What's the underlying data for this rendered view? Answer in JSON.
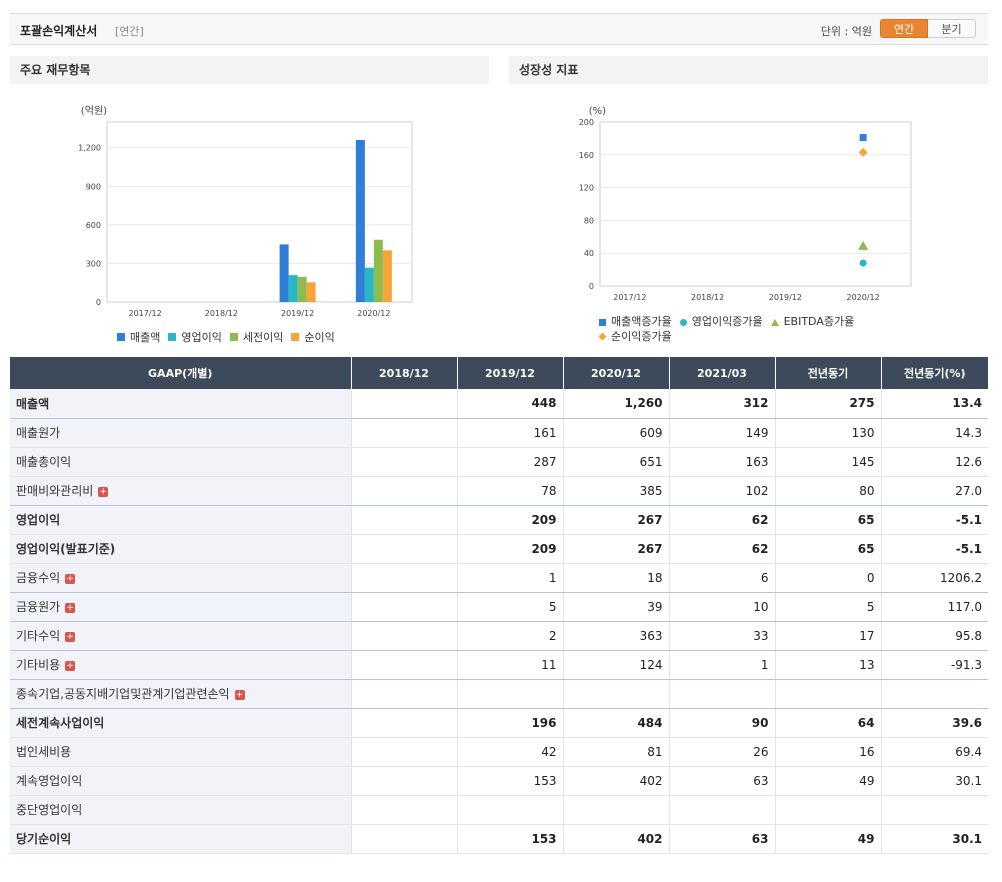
{
  "header": {
    "title": "포괄손익계산서",
    "period": "[연간]",
    "unit": "단위 : 억원",
    "toggle": [
      "연간",
      "분기"
    ]
  },
  "panel_left": {
    "title": "주요 재무항목",
    "unit": "(억원)"
  },
  "panel_right": {
    "title": "성장성 지표",
    "unit": "(%)"
  },
  "chart_data": [
    {
      "type": "bar",
      "title": "주요 재무항목",
      "ylabel": "(억원)",
      "categories": [
        "2017/12",
        "2018/12",
        "2019/12",
        "2020/12"
      ],
      "ylim": [
        0,
        1400
      ],
      "yticks": [
        "0",
        "300",
        "600",
        "900",
        "1,200"
      ],
      "series": [
        {
          "name": "매출액",
          "color": "#2f7ed8",
          "values": [
            null,
            null,
            448,
            1260
          ]
        },
        {
          "name": "영업이익",
          "color": "#27b7c5",
          "values": [
            null,
            null,
            209,
            267
          ]
        },
        {
          "name": "세전이익",
          "color": "#8ebb4f",
          "values": [
            null,
            null,
            196,
            484
          ]
        },
        {
          "name": "순이익",
          "color": "#f7a438",
          "values": [
            null,
            null,
            153,
            402
          ]
        }
      ],
      "grid": true,
      "legend": "bottom"
    },
    {
      "type": "scatter",
      "title": "성장성 지표",
      "ylabel": "(%)",
      "categories": [
        "2017/12",
        "2018/12",
        "2019/12",
        "2020/12"
      ],
      "ylim": [
        0,
        200
      ],
      "yticks": [
        "0",
        "40",
        "80",
        "120",
        "160",
        "200"
      ],
      "series": [
        {
          "name": "매출액증가율",
          "color": "#2f7ed8",
          "marker": "square",
          "values": [
            null,
            null,
            null,
            181
          ]
        },
        {
          "name": "영업이익증가율",
          "color": "#27b7c5",
          "marker": "circle",
          "values": [
            null,
            null,
            null,
            28
          ]
        },
        {
          "name": "EBITDA증가율",
          "color": "#8ebb4f",
          "marker": "triangle",
          "values": [
            null,
            null,
            null,
            49
          ]
        },
        {
          "name": "순이익증가율",
          "color": "#f7a438",
          "marker": "diamond",
          "values": [
            null,
            null,
            null,
            163
          ]
        }
      ],
      "grid": true,
      "legend": "bottom"
    }
  ],
  "table": {
    "headers": [
      "GAAP(개별)",
      "2018/12",
      "2019/12",
      "2020/12",
      "2021/03",
      "전년동기",
      "전년동기(%)"
    ],
    "rows": [
      {
        "label": "매출액",
        "values": [
          "",
          "448",
          "1,260",
          "312",
          "275",
          "13.4"
        ],
        "bold": true,
        "sep": true,
        "expand": false
      },
      {
        "label": "매출원가",
        "values": [
          "",
          "161",
          "609",
          "149",
          "130",
          "14.3"
        ],
        "bold": false,
        "sep": false,
        "expand": false
      },
      {
        "label": "매출총이익",
        "values": [
          "",
          "287",
          "651",
          "163",
          "145",
          "12.6"
        ],
        "bold": false,
        "sep": false,
        "expand": false
      },
      {
        "label": "판매비와관리비",
        "values": [
          "",
          "78",
          "385",
          "102",
          "80",
          "27.0"
        ],
        "bold": false,
        "sep": true,
        "expand": true
      },
      {
        "label": "영업이익",
        "values": [
          "",
          "209",
          "267",
          "62",
          "65",
          "-5.1"
        ],
        "bold": true,
        "sep": false,
        "expand": false
      },
      {
        "label": "영업이익(발표기준)",
        "values": [
          "",
          "209",
          "267",
          "62",
          "65",
          "-5.1"
        ],
        "bold": true,
        "sep": false,
        "expand": false
      },
      {
        "label": "금융수익",
        "values": [
          "",
          "1",
          "18",
          "6",
          "0",
          "1206.2"
        ],
        "bold": false,
        "sep": true,
        "expand": true
      },
      {
        "label": "금융원가",
        "values": [
          "",
          "5",
          "39",
          "10",
          "5",
          "117.0"
        ],
        "bold": false,
        "sep": true,
        "expand": true
      },
      {
        "label": "기타수익",
        "values": [
          "",
          "2",
          "363",
          "33",
          "17",
          "95.8"
        ],
        "bold": false,
        "sep": true,
        "expand": true
      },
      {
        "label": "기타비용",
        "values": [
          "",
          "11",
          "124",
          "1",
          "13",
          "-91.3"
        ],
        "bold": false,
        "sep": true,
        "expand": true
      },
      {
        "label": "종속기업,공동지배기업및관계기업관련손익",
        "values": [
          "",
          "",
          "",
          "",
          "",
          ""
        ],
        "bold": false,
        "sep": true,
        "expand": true
      },
      {
        "label": "세전계속사업이익",
        "values": [
          "",
          "196",
          "484",
          "90",
          "64",
          "39.6"
        ],
        "bold": true,
        "sep": false,
        "expand": false
      },
      {
        "label": "법인세비용",
        "values": [
          "",
          "42",
          "81",
          "26",
          "16",
          "69.4"
        ],
        "bold": false,
        "sep": false,
        "expand": false
      },
      {
        "label": "계속영업이익",
        "values": [
          "",
          "153",
          "402",
          "63",
          "49",
          "30.1"
        ],
        "bold": false,
        "sep": false,
        "expand": false
      },
      {
        "label": "중단영업이익",
        "values": [
          "",
          "",
          "",
          "",
          "",
          ""
        ],
        "bold": false,
        "sep": false,
        "expand": false
      },
      {
        "label": "당기순이익",
        "values": [
          "",
          "153",
          "402",
          "63",
          "49",
          "30.1"
        ],
        "bold": true,
        "sep": false,
        "expand": false
      }
    ]
  }
}
